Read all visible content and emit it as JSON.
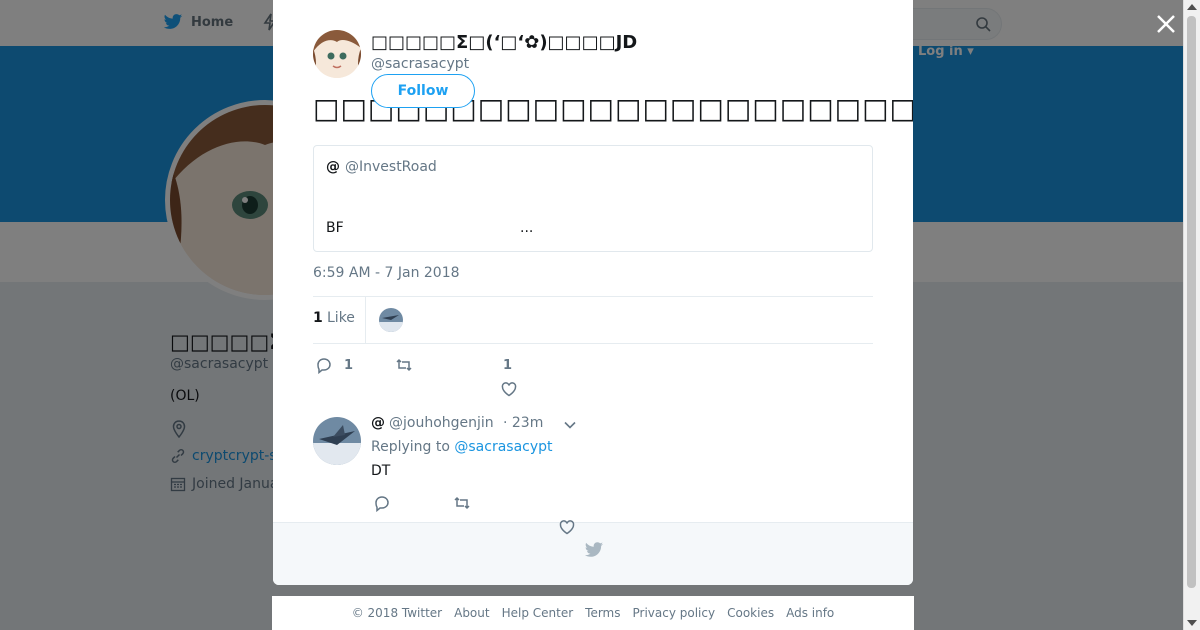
{
  "nav": {
    "home_label": "Home",
    "login_label": "Log in"
  },
  "profile": {
    "name": "□□□□□Σ□(‘",
    "handle": "@sacrasacypt",
    "bio": "(OL)",
    "link": "cryptcrypt-s",
    "joined": "Joined Janua"
  },
  "tweet": {
    "author_name": "□□□□□Σ□(‘□‘✿)□□□□JD",
    "author_handle": "@sacrasacypt",
    "follow_label": "Follow",
    "text": "□□□□□□□□□□□□□□□□□□□□□□□□□□□□□□□□□□",
    "quote": {
      "at": "@",
      "handle": "@InvestRoad",
      "line": "BF",
      "ellipsis": "..."
    },
    "timestamp": "6:59 AM - 7 Jan 2018",
    "likes_count": "1",
    "likes_label": "Like",
    "reply_count": "1",
    "like_action_count": "1"
  },
  "reply": {
    "at": "@",
    "handle": "@jouhohgenjin",
    "time": "· 23m",
    "replying_prefix": "Replying to",
    "replying_handle": "@sacrasacypt",
    "text": "DT"
  },
  "footer": {
    "copyright": "© 2018 Twitter",
    "about": "About",
    "help": "Help Center",
    "terms": "Terms",
    "privacy": "Privacy policy",
    "cookies": "Cookies",
    "ads": "Ads info"
  },
  "colors": {
    "brand_blue": "#1da1f2",
    "banner_blue": "#1b95e0",
    "overlay": "rgba(0,0,0,0.5)"
  },
  "icons": [
    "twitter-bird-icon",
    "search-icon",
    "close-icon",
    "reply-icon",
    "retweet-icon",
    "heart-icon",
    "chevron-down-icon",
    "location-icon",
    "link-icon",
    "calendar-icon"
  ]
}
